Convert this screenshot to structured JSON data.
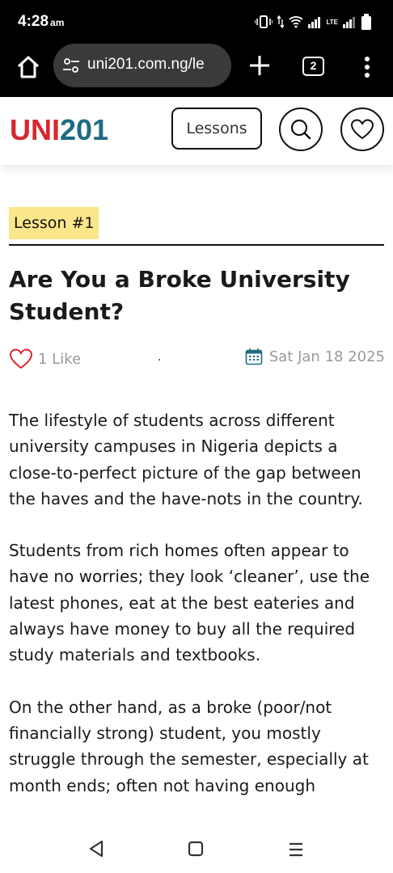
{
  "status": {
    "time": "4:28",
    "ampm": "am",
    "lte": "LTE"
  },
  "browser": {
    "url_visible": "uni201.com.ng/le",
    "tab_count": "2"
  },
  "site": {
    "logo_a": "UNI",
    "logo_b": "201",
    "lessons_label": "Lessons"
  },
  "article": {
    "badge": "Lesson #1",
    "title": "Are You a Broke University Student?",
    "likes": "1 Like",
    "separator": ".",
    "date": "Sat Jan 18 2025",
    "paragraphs": [
      "The lifestyle of students across different university campuses in Nigeria depicts a close-to-perfect picture of the gap between the haves and the have-nots in the country.",
      "Students from rich homes often appear to have no worries; they look ‘cleaner’, use the latest phones, eat at the best eateries and always have money to buy all the required study materials and textbooks.",
      "On the other hand, as a broke (poor/not financially strong) student, you mostly struggle through the semester, especially at month ends; often not having enough"
    ]
  },
  "colors": {
    "logo_red": "#d7282f",
    "logo_teal": "#1f6b84",
    "badge_bg": "#fce68a",
    "like_red": "#d7282f"
  },
  "icons": {
    "home": "home-icon",
    "tune": "site-settings-icon",
    "plus": "new-tab-icon",
    "tabs": "tab-switcher-icon",
    "menu": "more-vert-icon",
    "search": "search-icon",
    "favorite": "heart-icon",
    "like": "heart-outline-icon",
    "calendar": "calendar-icon",
    "nav_back": "back-triangle-icon",
    "nav_home": "home-square-icon",
    "nav_recents": "recents-lines-icon"
  }
}
